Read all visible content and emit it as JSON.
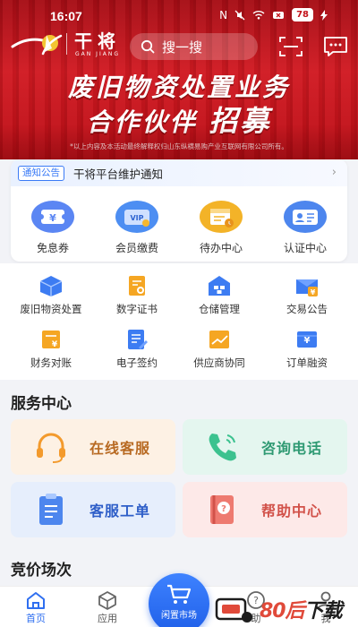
{
  "status_bar": {
    "time": "16:07",
    "icons": [
      "nfc-icon",
      "mute-icon",
      "wifi-icon",
      "battery-saver-icon"
    ],
    "battery": "78"
  },
  "header": {
    "brand_cn": "干将",
    "brand_en": "GAN JIANG",
    "search_placeholder": "搜一搜"
  },
  "banner": {
    "headline_line1": "废旧物资处置业务",
    "headline_line2_a": "合作伙伴",
    "headline_line2_b": "招募",
    "disclaimer": "*以上内容及本活动最终解释权归山东纵横易购产业互联网有限公司所有。"
  },
  "notice": {
    "tag": "通知公告",
    "text": "干将平台维护通知"
  },
  "quick_actions": [
    {
      "label": "免息券",
      "icon": "coupon-icon"
    },
    {
      "label": "会员缴费",
      "icon": "vip-card-icon"
    },
    {
      "label": "待办中心",
      "icon": "todo-calendar-icon"
    },
    {
      "label": "认证中心",
      "icon": "id-card-icon"
    }
  ],
  "grid": [
    {
      "label": "废旧物资处置",
      "icon": "box-icon"
    },
    {
      "label": "数字证书",
      "icon": "certificate-icon"
    },
    {
      "label": "仓储管理",
      "icon": "warehouse-icon"
    },
    {
      "label": "交易公告",
      "icon": "announcement-icon"
    },
    {
      "label": "财务对账",
      "icon": "finance-icon"
    },
    {
      "label": "电子签约",
      "icon": "e-sign-icon"
    },
    {
      "label": "供应商协同",
      "icon": "supplier-chart-icon"
    },
    {
      "label": "订单融资",
      "icon": "order-finance-icon"
    }
  ],
  "service_center": {
    "title": "服务中心",
    "items": [
      {
        "label": "在线客服",
        "icon": "headset-icon",
        "color": "#b86a22",
        "bg": "#fdf1e4"
      },
      {
        "label": "咨询电话",
        "icon": "phone-icon",
        "color": "#2f9a73",
        "bg": "#e4f6ef"
      },
      {
        "label": "客服工单",
        "icon": "clipboard-icon",
        "color": "#2e5ec8",
        "bg": "#e6eefc"
      },
      {
        "label": "帮助中心",
        "icon": "help-book-icon",
        "color": "#d2524a",
        "bg": "#fde9e8"
      }
    ]
  },
  "auction": {
    "title": "竞价场次"
  },
  "bottom_nav": {
    "home": "首页",
    "apps": "应用",
    "center": "闲置市场",
    "right_partial": "助",
    "me": "我"
  },
  "watermark": {
    "text_a": "80后",
    "text_b": "下载"
  },
  "colors": {
    "brand_red": "#c3121a",
    "accent_blue": "#3b7bf6"
  }
}
